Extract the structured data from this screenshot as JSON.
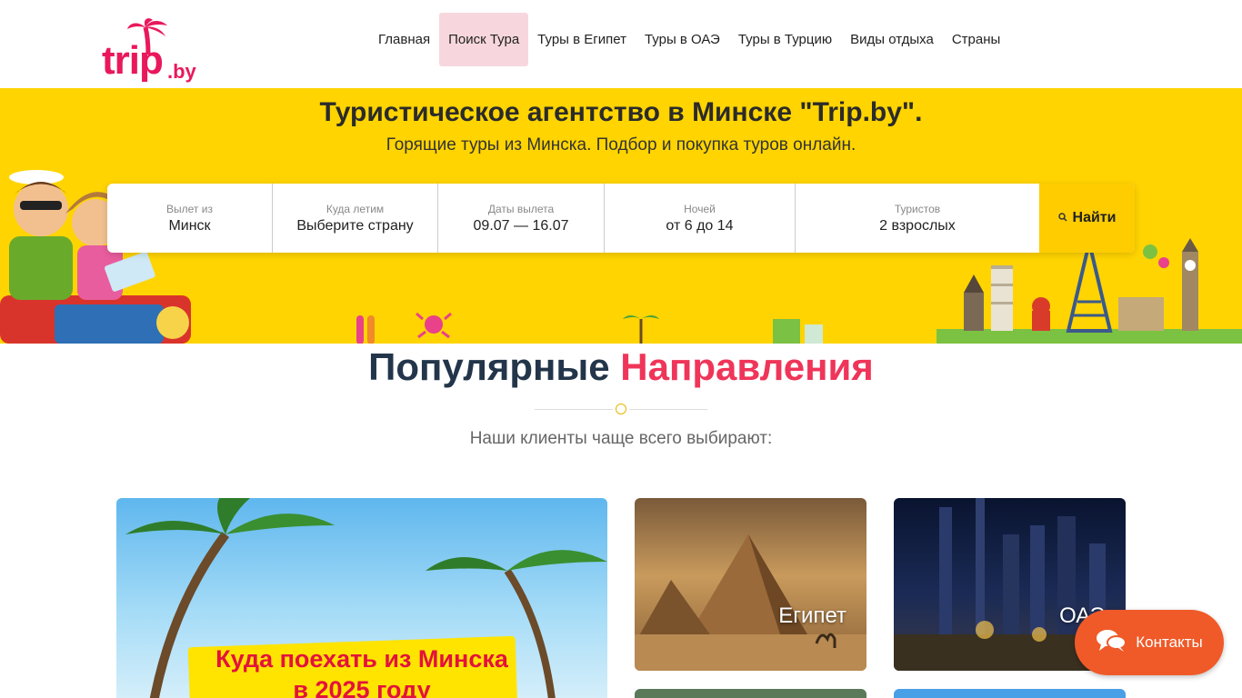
{
  "header": {
    "logo": {
      "main": "trip",
      "suffix": ".by"
    },
    "nav": [
      {
        "label": "Главная",
        "active": false
      },
      {
        "label": "Поиск Тура",
        "active": true
      },
      {
        "label": "Туры в Египет",
        "active": false
      },
      {
        "label": "Туры в ОАЭ",
        "active": false
      },
      {
        "label": "Туры в Турцию",
        "active": false
      },
      {
        "label": "Виды отдыха",
        "active": false
      },
      {
        "label": "Страны",
        "active": false
      }
    ]
  },
  "hero": {
    "title": "Туристическое агентство в Минске \"Trip.by\".",
    "subtitle": "Горящие туры из Минска. Подбор и покупка туров онлайн.",
    "background_color": "#ffd400"
  },
  "search": {
    "fields": [
      {
        "label": "Вылет из",
        "value": "Минск"
      },
      {
        "label": "Куда летим",
        "value": "Выберите страну"
      },
      {
        "label": "Даты вылета",
        "value": "09.07 — 16.07"
      },
      {
        "label": "Ночей",
        "value": "от 6 до 14"
      },
      {
        "label": "Туристов",
        "value": "2 взрослых"
      }
    ],
    "button_label": "Найти",
    "button_icon": "search-icon"
  },
  "popular": {
    "title_part1": "Популярные",
    "title_part2": "Направления",
    "subtitle": "Наши клиенты чаще всего выбирают:",
    "accent_color": "#ef3559",
    "cards": {
      "big_line1": "Куда поехать из Минска",
      "big_line2": "в 2025 году",
      "egypt": "Египет",
      "uae": "ОАЭ"
    }
  },
  "contacts": {
    "label": "Контакты",
    "icon": "chat-bubbles-icon",
    "color": "#f05a28"
  }
}
